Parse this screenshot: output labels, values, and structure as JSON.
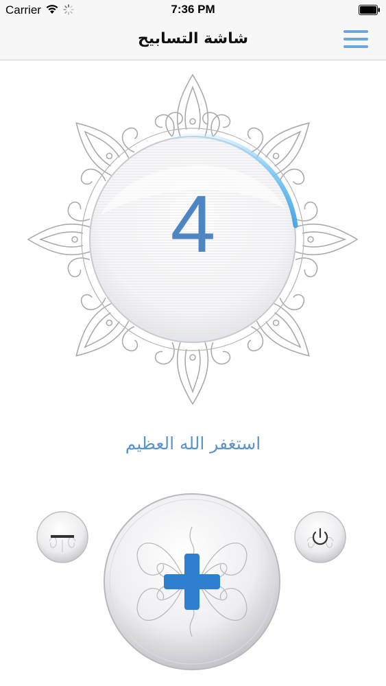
{
  "status_bar": {
    "carrier": "Carrier",
    "time": "7:36 PM",
    "icons": [
      "wifi-icon",
      "activity-spinner-icon",
      "battery-icon"
    ]
  },
  "nav": {
    "title": "شاشة التسابيح",
    "menu_icon": "hamburger-menu-icon",
    "accent_color": "#6aa6e0"
  },
  "counter": {
    "value": "4",
    "progress_arc_color": "#5fb6f0",
    "number_color": "#4e86c4"
  },
  "dhikr": {
    "text": "استغفر الله العظيم",
    "color": "#5a93cf"
  },
  "controls": {
    "decrement_icon": "minus-icon",
    "increment_icon": "plus-icon",
    "reset_icon": "power-icon",
    "plus_color": "#2f7fd0"
  }
}
